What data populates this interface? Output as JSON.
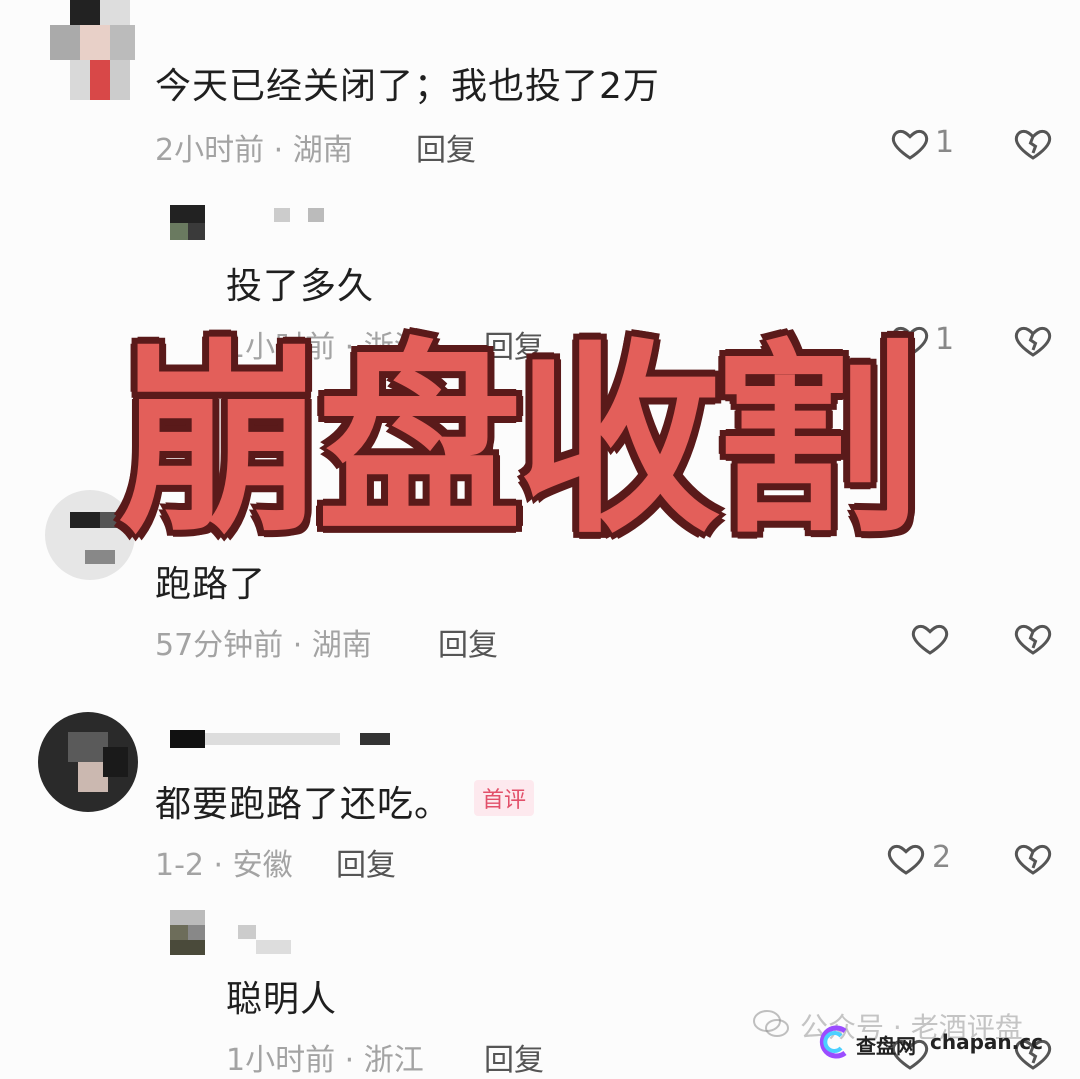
{
  "comments": [
    {
      "text": "今天已经关闭了；我也投了2万",
      "meta": "2小时前 · 湖南",
      "reply": "回复",
      "likes": "1"
    },
    {
      "text": "投了多久",
      "meta": "1小时前 · 浙江",
      "reply": "回复",
      "likes": "1"
    },
    {
      "text": "跑路了",
      "meta": "57分钟前 · 湖南",
      "reply": "回复",
      "likes": ""
    },
    {
      "text": "都要跑路了还吃。",
      "badge": "首评",
      "meta": "1-2 · 安徽",
      "reply": "回复",
      "likes": "2"
    },
    {
      "text": "聪明人",
      "meta": "1小时前 · 浙江",
      "reply": "回复",
      "likes": ""
    }
  ],
  "overlay_title": "崩盘收割",
  "watermark": {
    "account": "公众号 · 老酒评盘",
    "site_cn": "查盘网",
    "site_domain": "chapan.cc"
  },
  "colors": {
    "overlay": "#e35f5a",
    "badge": "#e2506a",
    "meta": "#a3a3a3"
  },
  "icons": [
    "heart-icon",
    "broken-heart-icon",
    "wechat-icon",
    "chapan-logo-icon"
  ]
}
